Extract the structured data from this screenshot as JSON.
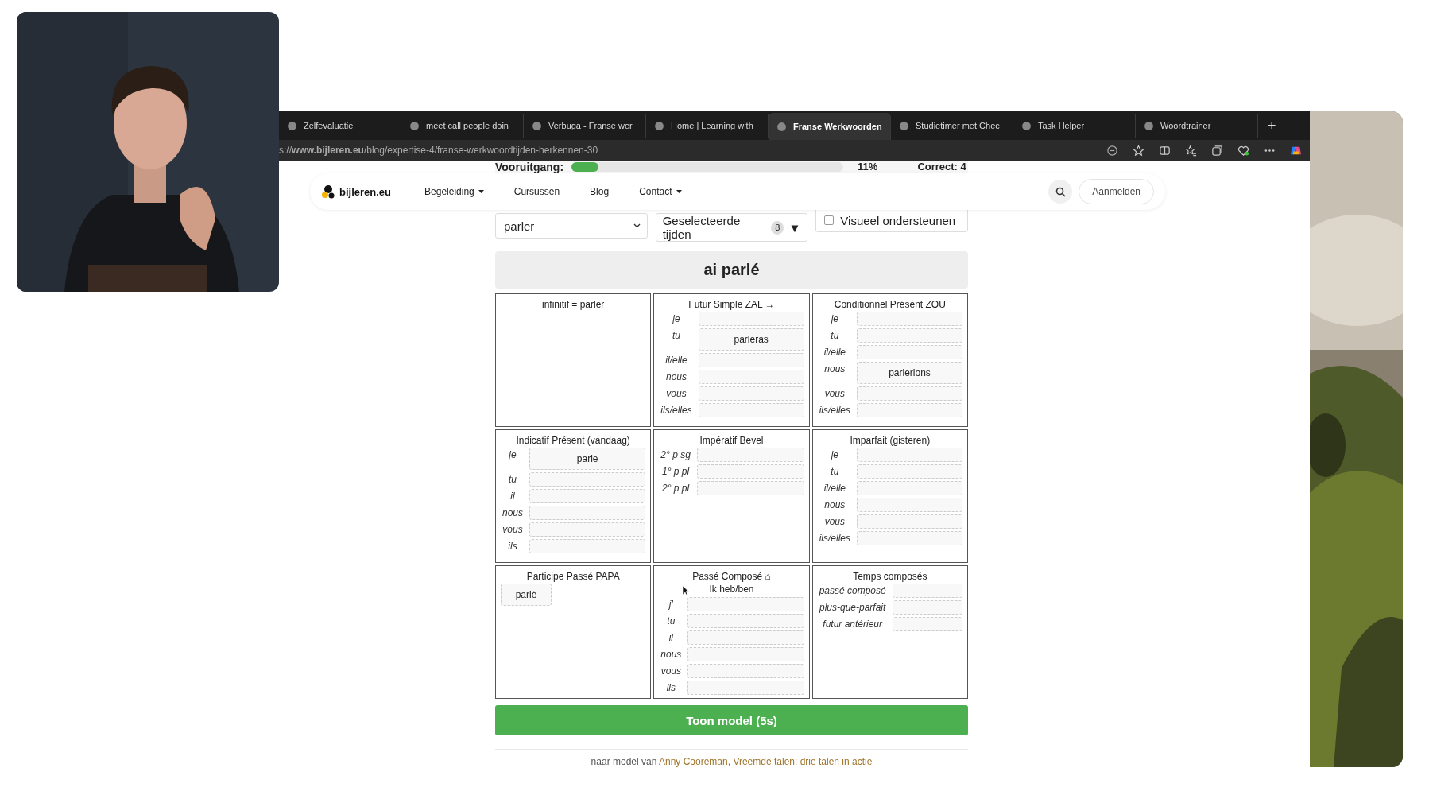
{
  "browser": {
    "tabs": [
      {
        "title": "Zelfevaluatie",
        "selected": false
      },
      {
        "title": "meet call people doin",
        "selected": false
      },
      {
        "title": "Verbuga - Franse wer",
        "selected": false
      },
      {
        "title": "Home | Learning with",
        "selected": false
      },
      {
        "title": "Franse Werkwoorden",
        "selected": true
      },
      {
        "title": "Studietimer met Chec",
        "selected": false
      },
      {
        "title": "Task Helper",
        "selected": false
      },
      {
        "title": "Woordtrainer",
        "selected": false
      }
    ],
    "new_tab": "+",
    "address": "s://**www.bijleren.eu**/blog/expertise-4/franse-werkwoordtijden-herkennen-30"
  },
  "progress": {
    "label": "Vooruitgang:",
    "level": 0.1,
    "percent": "11%",
    "correct": "Correct: 4"
  },
  "nav": {
    "brand": "bijleren.eu",
    "items": [
      {
        "label": "Begeleiding",
        "dropdown": true
      },
      {
        "label": "Cursussen",
        "dropdown": false
      },
      {
        "label": "Blog",
        "dropdown": false
      },
      {
        "label": "Contact",
        "dropdown": true
      }
    ],
    "login": "Aanmelden"
  },
  "controls": {
    "verb": "parler",
    "tenses": "Geselecteerde tijden",
    "tense_count": "8",
    "tenses_caret": "▼",
    "visual_support": {
      "label": "Visueel ondersteunen",
      "checked": false
    }
  },
  "prompt": "ai parlé",
  "cells": [
    {
      "kind": "blank",
      "title": "infinitif = parler"
    },
    {
      "kind": "table",
      "title": "Futur Simple ZAL →",
      "rows": [
        {
          "label": "je"
        },
        {
          "label": "tu",
          "value": "parleras"
        },
        {
          "label": "il/elle"
        },
        {
          "label": "nous"
        },
        {
          "label": "vous"
        },
        {
          "label": "ils/elles"
        }
      ]
    },
    {
      "kind": "table",
      "title": "Conditionnel Présent ZOU",
      "rows": [
        {
          "label": "je"
        },
        {
          "label": "tu"
        },
        {
          "label": "il/elle"
        },
        {
          "label": "nous",
          "value": "parlerions"
        },
        {
          "label": "vous"
        },
        {
          "label": "ils/elles"
        }
      ]
    },
    {
      "kind": "table",
      "title": "Indicatif Présent (vandaag)",
      "rows": [
        {
          "label": "je",
          "value": "parle"
        },
        {
          "label": "tu"
        },
        {
          "label": "il"
        },
        {
          "label": "nous"
        },
        {
          "label": "vous"
        },
        {
          "label": "ils"
        }
      ]
    },
    {
      "kind": "table",
      "title": "Impératif Bevel",
      "rows": [
        {
          "label": "2° p sg"
        },
        {
          "label": "1° p pl"
        },
        {
          "label": "2° p pl"
        }
      ]
    },
    {
      "kind": "table",
      "title": "Imparfait (gisteren)",
      "rows": [
        {
          "label": "je"
        },
        {
          "label": "tu"
        },
        {
          "label": "il/elle"
        },
        {
          "label": "nous"
        },
        {
          "label": "vous"
        },
        {
          "label": "ils/elles"
        }
      ]
    },
    {
      "kind": "single",
      "title": "Participe Passé PAPA",
      "value": "parlé"
    },
    {
      "kind": "table",
      "title": "Passé Composé ⌂",
      "subtitle": "Ik heb/ben",
      "rows": [
        {
          "label": "j'"
        },
        {
          "label": "tu"
        },
        {
          "label": "il"
        },
        {
          "label": "nous"
        },
        {
          "label": "vous"
        },
        {
          "label": "ils"
        }
      ]
    },
    {
      "kind": "table",
      "title": "Temps composés",
      "rows": [
        {
          "label": "passé composé"
        },
        {
          "label": "plus-que-parfait"
        },
        {
          "label": "futur antérieur"
        }
      ]
    }
  ],
  "button": "Toon model (5s)",
  "footer": {
    "text": "naar model van ",
    "link": "Anny Cooreman, Vreemde talen: drie talen in actie"
  }
}
